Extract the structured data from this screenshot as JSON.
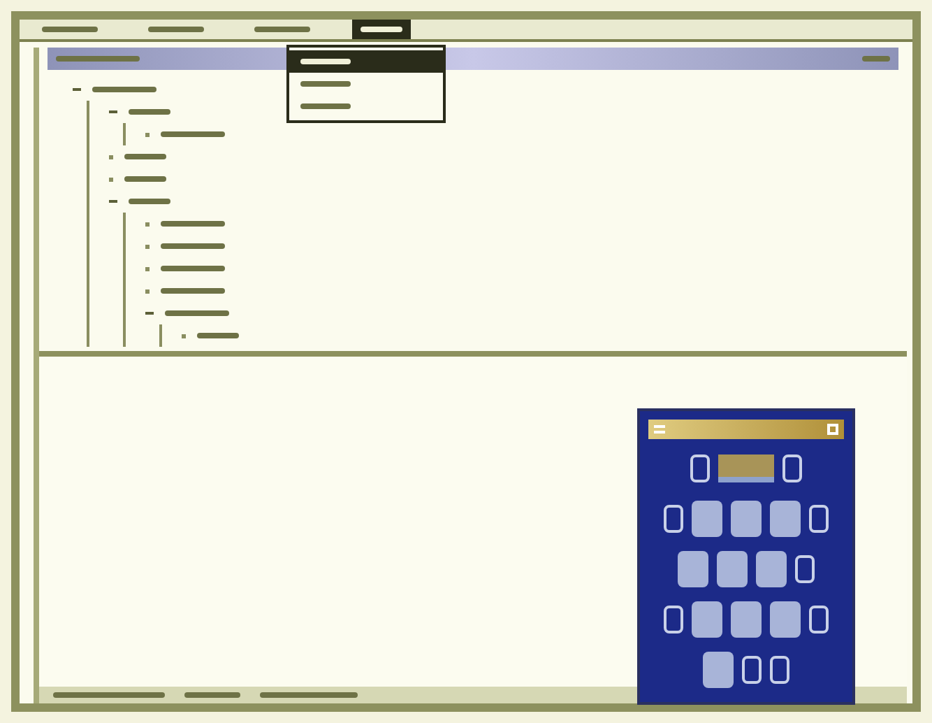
{
  "menu_bar": {
    "items": [
      {
        "selected": false
      },
      {
        "selected": false
      },
      {
        "selected": false
      },
      {
        "selected": true
      }
    ]
  },
  "dropdown": {
    "open": true,
    "items": [
      {
        "selected": true
      },
      {
        "selected": false
      },
      {
        "selected": false
      }
    ]
  },
  "tree": [
    {
      "expanded": true,
      "children": [
        {
          "expanded": true,
          "children": [
            {
              "expanded": false
            }
          ]
        },
        {
          "expanded": false
        },
        {
          "expanded": false
        },
        {
          "expanded": true,
          "children": [
            {
              "expanded": false
            },
            {
              "expanded": false
            },
            {
              "expanded": false
            },
            {
              "expanded": false
            },
            {
              "expanded": true,
              "children": [
                {
                  "expanded": false
                }
              ]
            }
          ]
        }
      ]
    }
  ],
  "keypad": {
    "rows": [
      [
        {
          "kind": "glyph"
        },
        {
          "kind": "wide"
        },
        {
          "kind": "glyph"
        }
      ],
      [
        {
          "kind": "glyph"
        },
        {
          "kind": "key"
        },
        {
          "kind": "key"
        },
        {
          "kind": "key"
        },
        {
          "kind": "glyph"
        }
      ],
      [
        {
          "kind": "key"
        },
        {
          "kind": "key"
        },
        {
          "kind": "key"
        },
        {
          "kind": "glyph"
        }
      ],
      [
        {
          "kind": "glyph"
        },
        {
          "kind": "key"
        },
        {
          "kind": "key"
        },
        {
          "kind": "key"
        },
        {
          "kind": "glyph"
        }
      ],
      [
        {
          "kind": "key"
        },
        {
          "kind": "glyph"
        },
        {
          "kind": "glyph"
        }
      ]
    ]
  }
}
